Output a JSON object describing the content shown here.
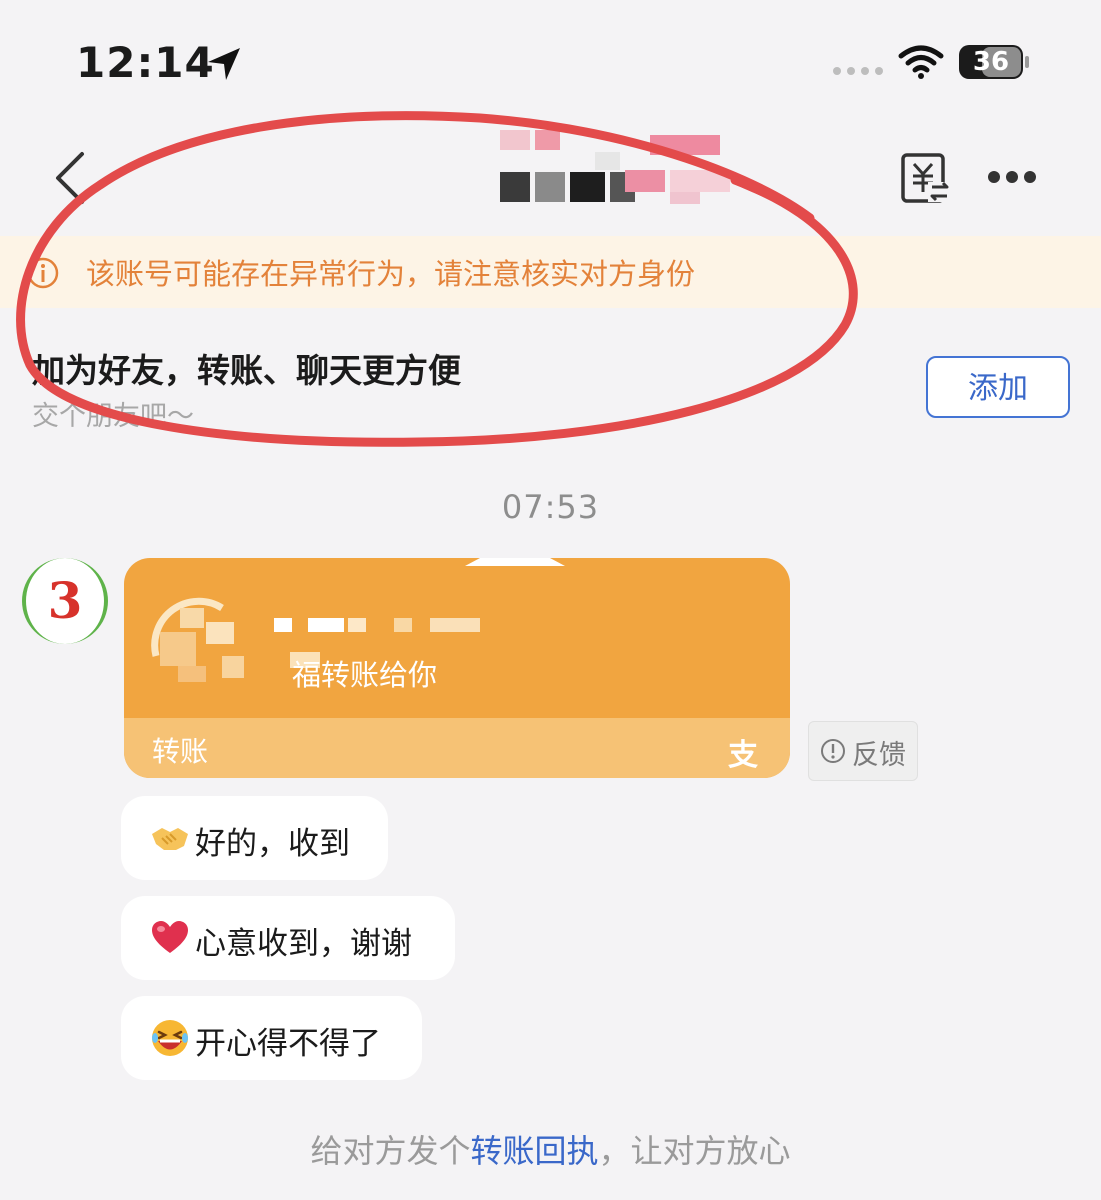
{
  "status_bar": {
    "time": "12:14",
    "battery": "36",
    "icons": [
      "location-arrow-icon",
      "signal-dots-icon",
      "wifi-icon",
      "battery-icon"
    ]
  },
  "nav": {
    "icons": [
      "chevron-left-icon",
      "yuan-transfer-icon",
      "more-icon"
    ]
  },
  "warning": {
    "text": "该账号可能存在异常行为，请注意核实对方身份",
    "icon": "info-circle-icon"
  },
  "friend_prompt": {
    "title": "加为好友，转账、聊天更方便",
    "subtitle": "交个朋友吧～",
    "add_label": "添加"
  },
  "chat": {
    "timestamp": "07:53",
    "avatar_text": "3",
    "transfer_card": {
      "subtitle_visible": "福转账给你",
      "footer_label": "转账",
      "footer_icon": "支"
    },
    "feedback_label": "反馈",
    "messages": [
      {
        "emoji": "handshake-emoji",
        "text": "好的，收到"
      },
      {
        "emoji": "heart-emoji",
        "text": "心意收到，谢谢"
      },
      {
        "emoji": "laughing-emoji",
        "text": "开心得不得了"
      }
    ]
  },
  "bottom_prompt": {
    "prefix": "给对方发个",
    "link": "转账回执",
    "suffix": "，让对方放心"
  },
  "colors": {
    "warning_text": "#e3823a",
    "card_orange": "#f1a540",
    "link_blue": "#3a68c9",
    "annotation_red": "#e34b4b"
  }
}
